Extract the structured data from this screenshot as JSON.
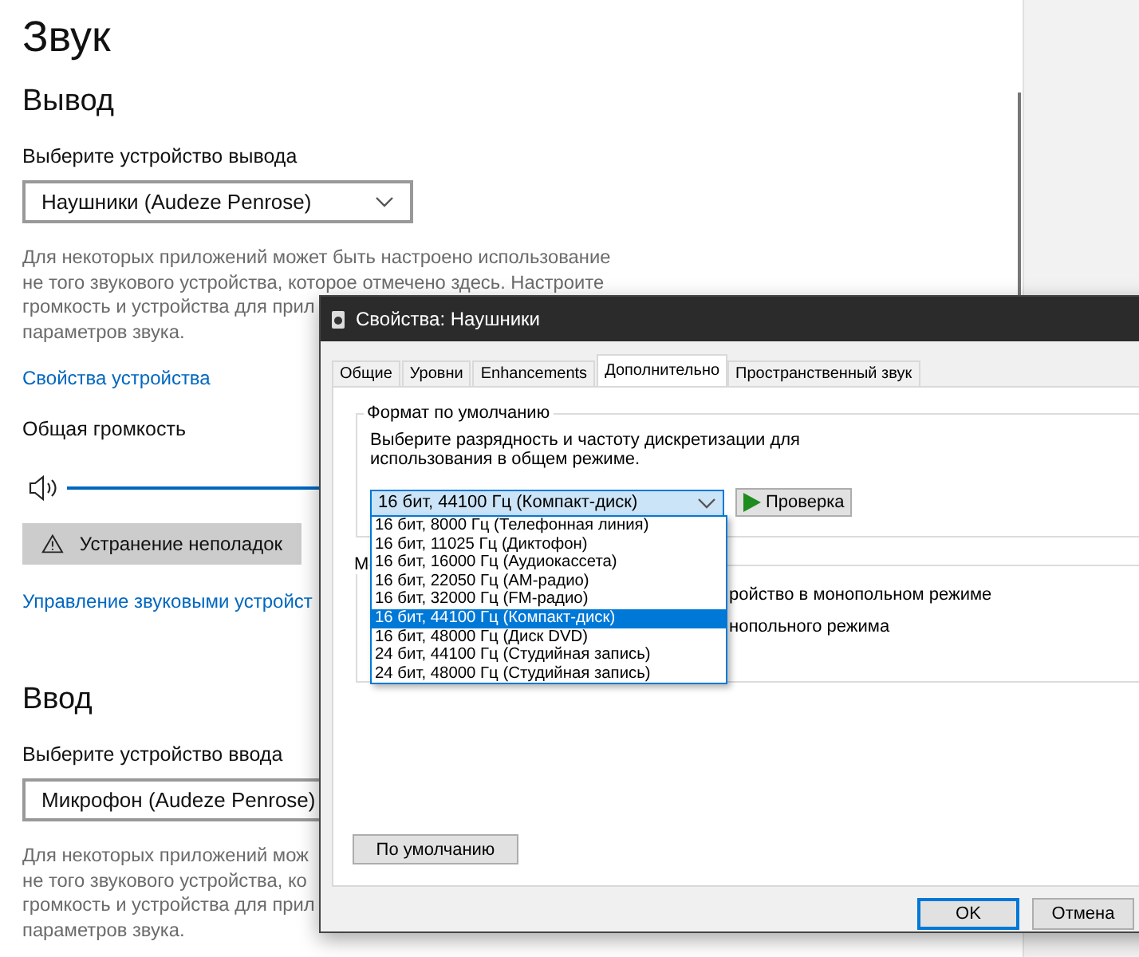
{
  "settings": {
    "title": "Звук",
    "output": {
      "heading": "Вывод",
      "device_label": "Выберите устройство вывода",
      "device": "Наушники (Audeze Penrose)",
      "note_lines": [
        "Для некоторых приложений может быть настроено использование",
        "не того звукового устройства, которое отмечено здесь. Настроите",
        "громкость и устройства для прил",
        "параметров звука."
      ],
      "properties_link": "Свойства устройства",
      "volume_label": "Общая громкость",
      "troubleshoot_button": "Устранение неполадок",
      "manage_link": "Управление звуковыми устройст"
    },
    "input": {
      "heading": "Ввод",
      "device_label": "Выберите устройство ввода",
      "device": "Микрофон (Audeze Penrose)",
      "note_lines": [
        "Для некоторых приложений мож",
        "не того звукового устройства, ко",
        "громкость и устройства для прил",
        "параметров звука."
      ]
    }
  },
  "dialog": {
    "title": "Свойства: Наушники",
    "tabs": [
      {
        "label": "Общие",
        "selected": false
      },
      {
        "label": "Уровни",
        "selected": false
      },
      {
        "label": "Enhancements",
        "selected": false
      },
      {
        "label": "Дополнительно",
        "selected": true
      },
      {
        "label": "Пространственный звук",
        "selected": false
      }
    ],
    "default_format": {
      "legend": "Формат по умолчанию",
      "description": "Выберите разрядность и частоту дискретизации для использования в общем режиме.",
      "value": "16 бит, 44100 Гц (Компакт-диск)",
      "options": [
        {
          "label": "16 бит, 8000 Гц (Телефонная линия)",
          "selected": false
        },
        {
          "label": "16 бит, 11025 Гц (Диктофон)",
          "selected": false
        },
        {
          "label": "16 бит, 16000 Гц (Аудиокассета)",
          "selected": false
        },
        {
          "label": "16 бит, 22050 Гц (АМ-радио)",
          "selected": false
        },
        {
          "label": "16 бит, 32000 Гц (FM-радио)",
          "selected": false
        },
        {
          "label": "16 бит, 44100 Гц (Компакт-диск)",
          "selected": true
        },
        {
          "label": "16 бит, 48000 Гц (Диск DVD)",
          "selected": false
        },
        {
          "label": "24 бит, 44100 Гц (Студийная запись)",
          "selected": false
        },
        {
          "label": "24 бит, 48000 Гц (Студийная запись)",
          "selected": false
        }
      ],
      "test_button": "Проверка"
    },
    "exclusive_mode": {
      "legend": "М",
      "lines": [
        "ройство в монопольном режиме",
        "нопольного режима"
      ]
    },
    "restore_button": "По умолчанию",
    "buttons": [
      {
        "label": "OK",
        "default": true
      },
      {
        "label": "Отмена",
        "default": false
      }
    ]
  }
}
